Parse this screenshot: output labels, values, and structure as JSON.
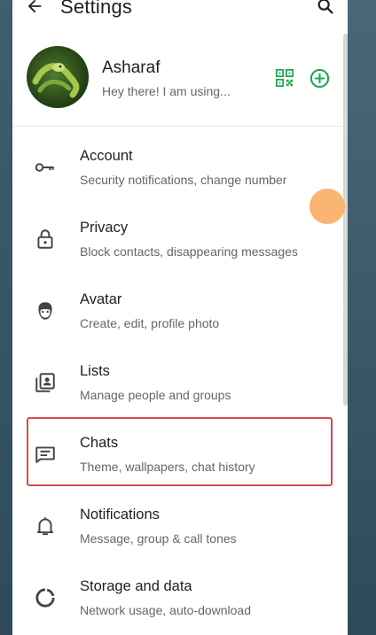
{
  "header": {
    "title": "Settings"
  },
  "profile": {
    "name": "Asharaf",
    "status": "Hey there! I am using..."
  },
  "menu": [
    {
      "label": "Account",
      "sub": "Security notifications, change number",
      "icon": "key-icon"
    },
    {
      "label": "Privacy",
      "sub": "Block contacts, disappearing messages",
      "icon": "lock-icon"
    },
    {
      "label": "Avatar",
      "sub": "Create, edit, profile photo",
      "icon": "avatar-face-icon"
    },
    {
      "label": "Lists",
      "sub": "Manage people and groups",
      "icon": "contact-list-icon"
    },
    {
      "label": "Chats",
      "sub": "Theme, wallpapers, chat history",
      "icon": "chat-icon"
    },
    {
      "label": "Notifications",
      "sub": "Message, group & call tones",
      "icon": "bell-icon"
    },
    {
      "label": "Storage and data",
      "sub": "Network usage, auto-download",
      "icon": "storage-circle-icon"
    }
  ],
  "colors": {
    "accent": "#1fa855",
    "highlight_border": "#d84a4a",
    "touch_indicator": "#f8ad62"
  }
}
